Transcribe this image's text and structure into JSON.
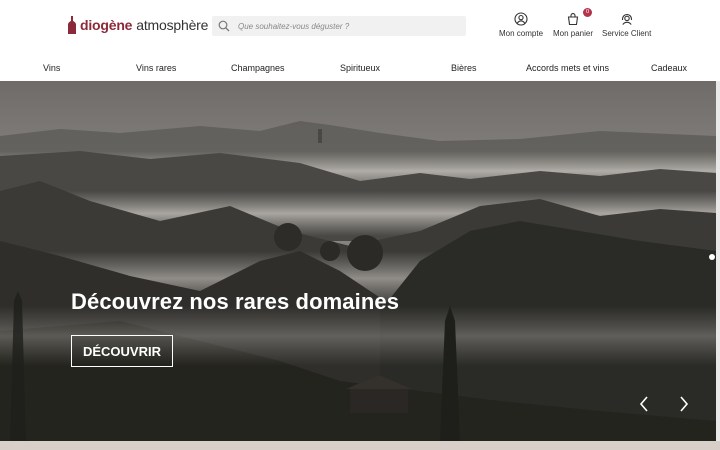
{
  "brand": {
    "name": "diogène",
    "sub": "atmosphère",
    "color": "#8b2a3a"
  },
  "search": {
    "placeholder": "Que souhaitez-vous déguster ?",
    "icon": "search-icon"
  },
  "header_actions": {
    "account": {
      "label": "Mon compte",
      "icon": "user-circle-icon"
    },
    "cart": {
      "label": "Mon panier",
      "icon": "basket-icon",
      "count": "0"
    },
    "service": {
      "label": "Service Client",
      "icon": "headset-icon"
    }
  },
  "nav": [
    "Vins",
    "Vins rares",
    "Champagnes",
    "Spiritueux",
    "Bières",
    "Accords mets et vins",
    "Cadeaux"
  ],
  "hero": {
    "title": "Découvrez nos rares domaines",
    "cta": "DÉCOUVRIR",
    "prev_icon": "chevron-left-icon",
    "next_icon": "chevron-right-icon"
  },
  "colors": {
    "badge": "#b2334a",
    "accent": "#8b2a3a"
  }
}
